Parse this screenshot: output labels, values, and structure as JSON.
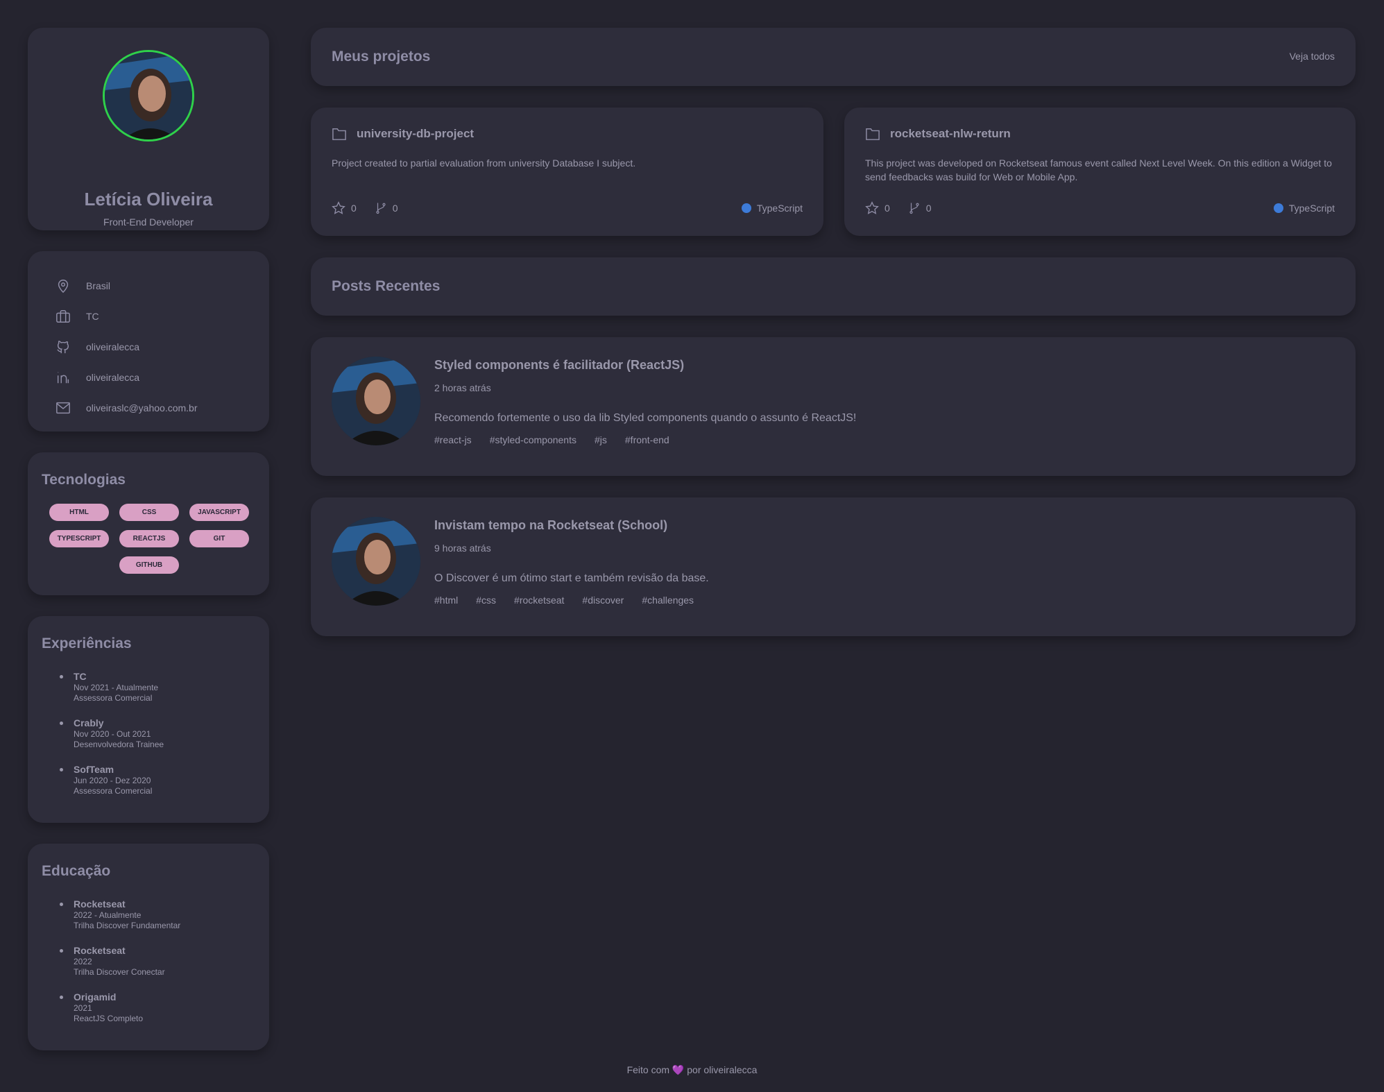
{
  "profile": {
    "name": "Letícia Oliveira",
    "role": "Front-End Developer"
  },
  "info": {
    "items": [
      {
        "icon": "location-pin-icon",
        "text": "Brasil"
      },
      {
        "icon": "briefcase-icon",
        "text": "TC"
      },
      {
        "icon": "github-icon",
        "text": "oliveiralecca"
      },
      {
        "icon": "linkedin-icon",
        "text": "oliveiralecca"
      },
      {
        "icon": "mail-icon",
        "text": "oliveiraslc@yahoo.com.br"
      }
    ]
  },
  "technologies": {
    "title": "Tecnologias",
    "items": [
      "HTML",
      "CSS",
      "JAVASCRIPT",
      "TYPESCRIPT",
      "REACTJS",
      "GIT",
      "GITHUB"
    ]
  },
  "experiences": {
    "title": "Experiências",
    "items": [
      {
        "title": "TC",
        "period": "Nov 2021 - Atualmente",
        "role": "Assessora Comercial"
      },
      {
        "title": "Crably",
        "period": "Nov 2020 - Out 2021",
        "role": "Desenvolvedora Trainee"
      },
      {
        "title": "SofTeam",
        "period": "Jun 2020 - Dez 2020",
        "role": "Assessora Comercial"
      }
    ]
  },
  "education": {
    "title": "Educação",
    "items": [
      {
        "title": "Rocketseat",
        "period": "2022 - Atualmente",
        "course": "Trilha Discover Fundamentar"
      },
      {
        "title": "Rocketseat",
        "period": "2022",
        "course": "Trilha Discover Conectar"
      },
      {
        "title": "Origamid",
        "period": "2021",
        "course": "ReactJS Completo"
      }
    ]
  },
  "projects": {
    "title": "Meus projetos",
    "link": "Veja todos",
    "repos": [
      {
        "name": "university-db-project",
        "description": "Project created to partial evaluation from university Database I subject.",
        "stars": "0",
        "forks": "0",
        "language": "TypeScript"
      },
      {
        "name": "rocketseat-nlw-return",
        "description": "This project was developed on Rocketseat famous event called Next Level Week. On this edition a Widget to send feedbacks was build for Web or Mobile App.",
        "stars": "0",
        "forks": "0",
        "language": "TypeScript"
      }
    ]
  },
  "posts": {
    "title": "Posts Recentes",
    "items": [
      {
        "title": "Styled components é facilitador (ReactJS)",
        "time": "2 horas atrás",
        "body": "Recomendo fortemente o uso da lib Styled components quando o assunto é ReactJS!",
        "tags": [
          "#react-js",
          "#styled-components",
          "#js",
          "#front-end"
        ]
      },
      {
        "title": "Invistam tempo na Rocketseat (School)",
        "time": "9 horas atrás",
        "body": "O Discover é um ótimo start e também revisão da base.",
        "tags": [
          "#html",
          "#css",
          "#rocketseat",
          "#discover",
          "#challenges"
        ]
      }
    ]
  },
  "footer": {
    "prefix": "Feito com",
    "heart": "💜",
    "suffix": "por oliveiralecca"
  },
  "colors": {
    "background": "#25242f",
    "card": "#2e2d3b",
    "avatar_ring": "#2fd14a",
    "tech_pill": "#d9a0c4",
    "typescript_dot": "#3d7bd8"
  }
}
